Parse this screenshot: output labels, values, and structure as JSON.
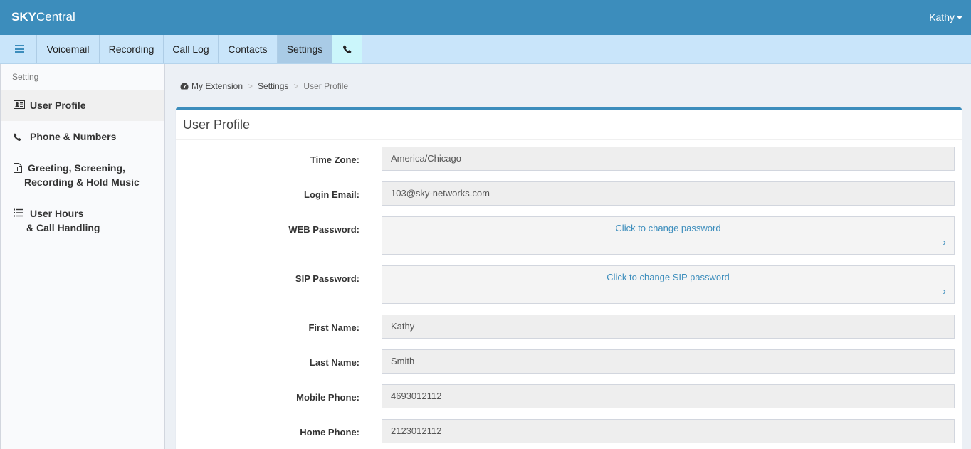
{
  "header": {
    "brand_bold": "SKY",
    "brand_rest": "Central",
    "user_name": "Kathy"
  },
  "nav": {
    "tabs": [
      "Voicemail",
      "Recording",
      "Call Log",
      "Contacts",
      "Settings"
    ],
    "active_tab": "Settings"
  },
  "sidebar": {
    "header": "Setting",
    "items": [
      {
        "line1": "User Profile",
        "line2": "",
        "icon": "id-card-icon",
        "active": true
      },
      {
        "line1": "Phone & Numbers",
        "line2": "",
        "icon": "phone-icon",
        "active": false
      },
      {
        "line1": "Greeting, Screening,",
        "line2": "Recording & Hold Music",
        "icon": "audio-file-icon",
        "active": false
      },
      {
        "line1": "User Hours",
        "line2": "& Call Handling",
        "icon": "list-icon",
        "active": false
      }
    ]
  },
  "breadcrumb": {
    "root": "My Extension",
    "middle": "Settings",
    "current": "User Profile",
    "root_icon": "dashboard-icon"
  },
  "profile": {
    "title": "User Profile",
    "time_zone_label": "Time Zone:",
    "time_zone": "America/Chicago",
    "login_email_label": "Login Email:",
    "login_email": "103@sky-networks.com",
    "web_password_label": "WEB Password:",
    "web_password_link": "Click to change password",
    "sip_password_label": "SIP Password:",
    "sip_password_link": "Click to change SIP password",
    "first_name_label": "First Name:",
    "first_name": "Kathy",
    "last_name_label": "Last Name:",
    "last_name": "Smith",
    "mobile_phone_label": "Mobile Phone:",
    "mobile_phone": "4693012112",
    "home_phone_label": "Home Phone:",
    "home_phone": "2123012112"
  },
  "colors": {
    "header_bg": "#3c8dbc",
    "nav_bg": "#c9e5fa",
    "nav_active": "#a9cbe6",
    "link": "#3c8dbc"
  }
}
